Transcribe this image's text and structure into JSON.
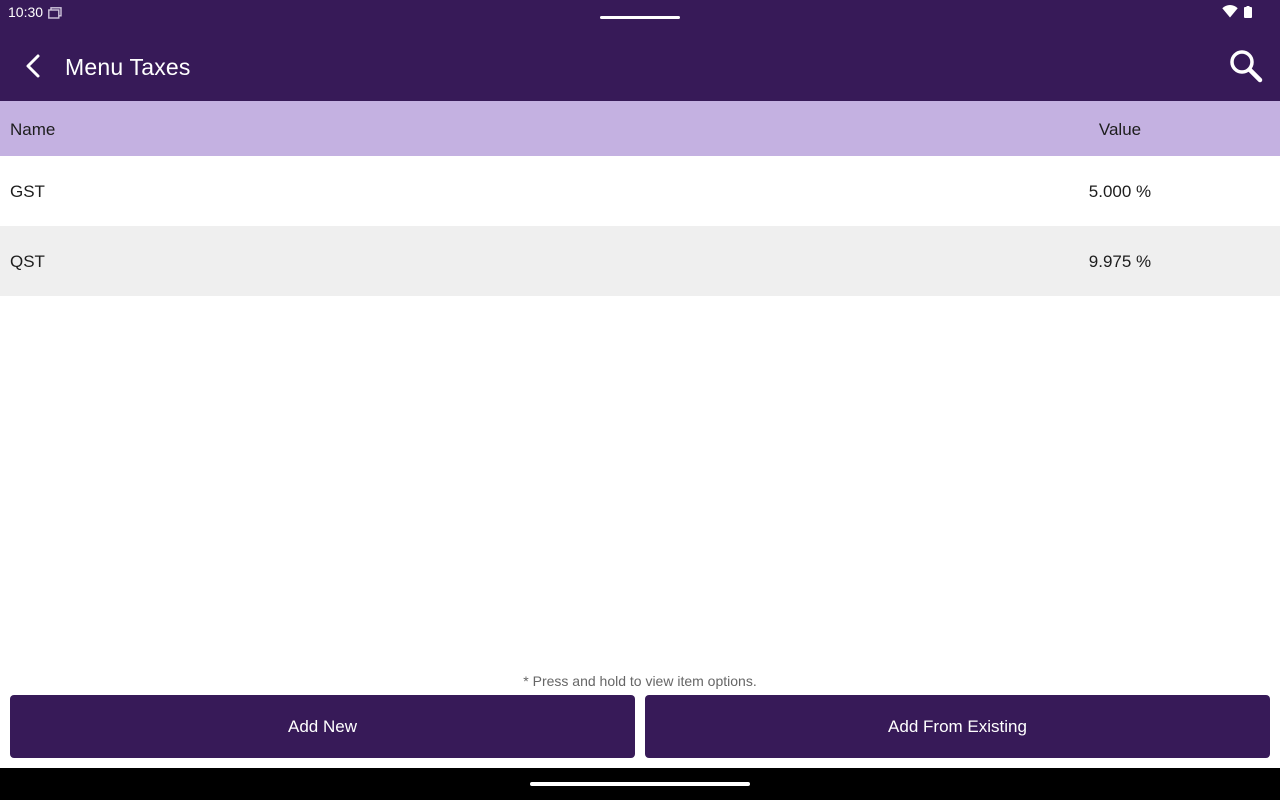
{
  "status_bar": {
    "time": "10:30",
    "icons": [
      "screen-icon",
      "wifi-icon",
      "battery-icon"
    ]
  },
  "app_bar": {
    "title": "Menu Taxes",
    "back_icon": "chevron-left-icon",
    "search_icon": "search-icon"
  },
  "table": {
    "columns": [
      "Name",
      "Value"
    ],
    "rows": [
      {
        "name": "GST",
        "value": "5.000 %"
      },
      {
        "name": "QST",
        "value": "9.975 %"
      }
    ]
  },
  "footer": {
    "hint": "* Press and hold to view item options.",
    "add_new_label": "Add New",
    "add_from_existing_label": "Add From Existing"
  },
  "colors": {
    "primary": "#371a58",
    "header": "#c4b1e1",
    "row_alt": "#efefef"
  }
}
